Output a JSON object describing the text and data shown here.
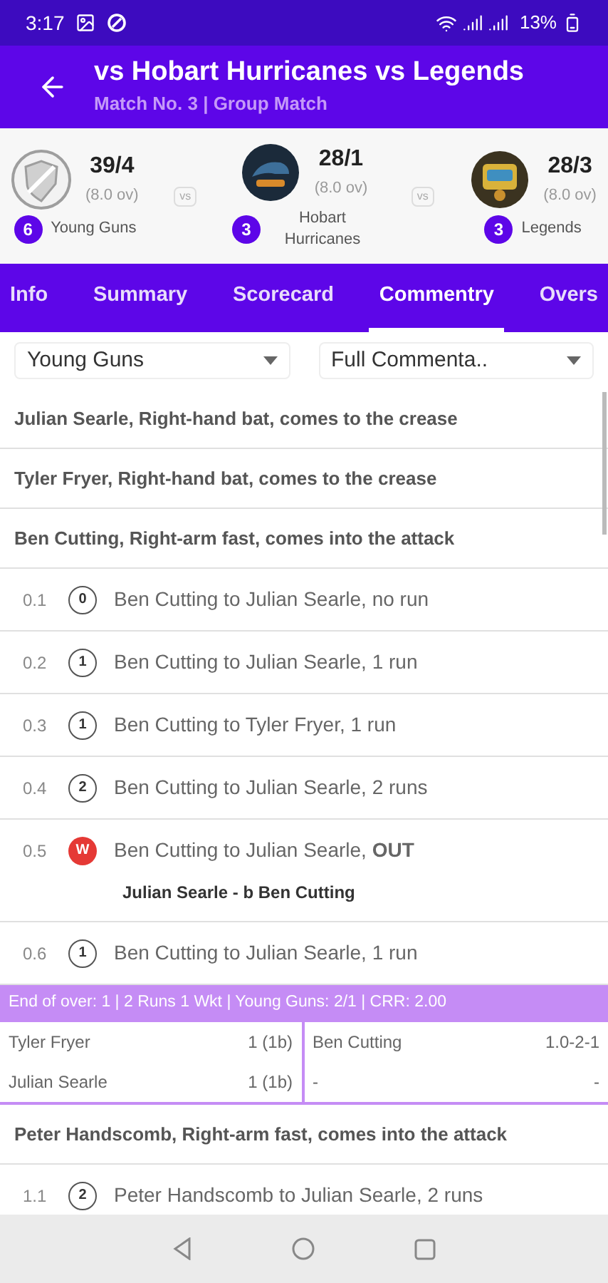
{
  "status_bar": {
    "time": "3:17",
    "battery": "13%"
  },
  "header": {
    "title": "vs Hobart Hurricanes vs Legends",
    "subtitle": "Match No. 3 | Group Match"
  },
  "teams": [
    {
      "score": "39/4",
      "overs": "(8.0 ov)",
      "count": "6",
      "name": "Young Guns"
    },
    {
      "score": "28/1",
      "overs": "(8.0 ov)",
      "count": "3",
      "name": "Hobart Hurricanes"
    },
    {
      "score": "28/3",
      "overs": "(8.0 ov)",
      "count": "3",
      "name": "Legends"
    }
  ],
  "vs_labels": [
    "vs",
    "vs"
  ],
  "tabs": [
    {
      "label": "Info",
      "selected": false
    },
    {
      "label": "Summary",
      "selected": false
    },
    {
      "label": "Scorecard",
      "selected": false
    },
    {
      "label": "Commentry",
      "selected": true
    },
    {
      "label": "Overs",
      "selected": false
    }
  ],
  "filters": [
    {
      "value": "Young Guns"
    },
    {
      "value": "Full Commenta.."
    }
  ],
  "commentary": [
    {
      "kind": "event",
      "text": "Julian Searle, Right-hand bat, comes to the crease"
    },
    {
      "kind": "event",
      "text": "Tyler Fryer, Right-hand bat, comes to the crease"
    },
    {
      "kind": "event",
      "text": "Ben Cutting, Right-arm fast, comes into the attack"
    },
    {
      "kind": "ball",
      "over": "0.1",
      "ball": "0",
      "wicket": false,
      "text": "Ben Cutting to Julian Searle, no run"
    },
    {
      "kind": "ball",
      "over": "0.2",
      "ball": "1",
      "wicket": false,
      "text": "Ben Cutting to Julian Searle, 1 run"
    },
    {
      "kind": "ball",
      "over": "0.3",
      "ball": "1",
      "wicket": false,
      "text": "Ben Cutting to Tyler Fryer, 1 run"
    },
    {
      "kind": "ball",
      "over": "0.4",
      "ball": "2",
      "wicket": false,
      "text": "Ben Cutting to Julian Searle, 2 runs"
    },
    {
      "kind": "ball",
      "over": "0.5",
      "ball": "W",
      "wicket": true,
      "text": "Ben Cutting to Julian Searle, **OUT**",
      "dismissal": "Julian Searle - b Ben Cutting"
    },
    {
      "kind": "ball",
      "over": "0.6",
      "ball": "1",
      "wicket": false,
      "text": "Ben Cutting to Julian Searle, 1 run"
    },
    {
      "kind": "summary",
      "text": "End of over: 1 | 2 Runs 1 Wkt | Young Guns: 2/1 | CRR: 2.00",
      "batters": [
        {
          "name": "Tyler Fryer",
          "score": "1 (1b)"
        },
        {
          "name": "Julian Searle",
          "score": "1 (1b)"
        }
      ],
      "bowlers": [
        {
          "name": "Ben Cutting",
          "score": "1.0-2-1"
        },
        {
          "name": "-",
          "score": "-"
        }
      ]
    },
    {
      "kind": "event",
      "text": "Peter Handscomb, Right-arm fast, comes into the attack"
    },
    {
      "kind": "ball",
      "over": "1.1",
      "ball": "2",
      "wicket": false,
      "text": "Peter Handscomb to Julian Searle, 2 runs"
    }
  ]
}
